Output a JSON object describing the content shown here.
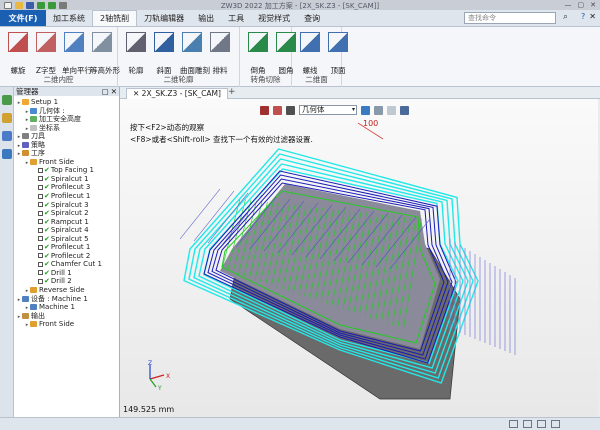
{
  "window": {
    "title": "ZW3D 2022      加工方案 - [2X_SK.Z3 - [SK_CAM]]"
  },
  "menu": {
    "file": "文件(F)",
    "tabs": [
      "加工系统",
      "2轴铣削",
      "刀轨编辑器",
      "输出",
      "工具",
      "视觉样式",
      "查询"
    ],
    "active": 1,
    "search_placeholder": "查找命令"
  },
  "ribbon": {
    "groups": [
      {
        "label": "二维内腔",
        "buttons": [
          "螺旋",
          "Z字型",
          "单向平行",
          "等高外形"
        ]
      },
      {
        "label": "二维轮廓",
        "buttons": [
          "轮廓",
          "斜面",
          "曲面雕刻",
          "排料"
        ]
      },
      {
        "label": "转角切除",
        "buttons": [
          "倒角",
          "圆角"
        ]
      },
      {
        "label": "二维面",
        "buttons": [
          "螺线",
          "顶面"
        ]
      }
    ]
  },
  "panel": {
    "title": "管理器",
    "tree": [
      {
        "d": 0,
        "text": "Setup 1",
        "icon": "#f0a830"
      },
      {
        "d": 1,
        "text": "几何体 :",
        "icon": "#4a8ad0"
      },
      {
        "d": 1,
        "text": "加工安全高度",
        "icon": "#60b060"
      },
      {
        "d": 1,
        "text": "坐标系",
        "icon": "#c0c0c0"
      },
      {
        "d": 0,
        "text": "刀具",
        "icon": "#808080"
      },
      {
        "d": 0,
        "text": "策略",
        "icon": "#6060c0"
      },
      {
        "d": 0,
        "text": "工序",
        "icon": "#d09030"
      },
      {
        "d": 1,
        "text": "Front Side",
        "icon": "#e0a030"
      },
      {
        "d": 2,
        "text": "Top Facing 1",
        "check": true
      },
      {
        "d": 2,
        "text": "Spiralcut 1",
        "check": true
      },
      {
        "d": 2,
        "text": "Profilecut 3",
        "check": true
      },
      {
        "d": 2,
        "text": "Profilecut 1",
        "check": true
      },
      {
        "d": 2,
        "text": "Spiralcut 3",
        "check": true
      },
      {
        "d": 2,
        "text": "Spiralcut 2",
        "check": true
      },
      {
        "d": 2,
        "text": "Rampcut 1",
        "check": true
      },
      {
        "d": 2,
        "text": "Spiralcut 4",
        "check": true
      },
      {
        "d": 2,
        "text": "Spiralcut 5",
        "check": true
      },
      {
        "d": 2,
        "text": "Profilecut 1",
        "check": true
      },
      {
        "d": 2,
        "text": "Profilecut 2",
        "check": true
      },
      {
        "d": 2,
        "text": "Chamfer Cut 1",
        "check": true
      },
      {
        "d": 2,
        "text": "Drill 1",
        "check": true
      },
      {
        "d": 2,
        "text": "Drill 2",
        "check": true
      },
      {
        "d": 1,
        "text": "Reverse Side",
        "icon": "#e0a030"
      },
      {
        "d": 0,
        "text": "设备 : Machine 1",
        "icon": "#5080c0"
      },
      {
        "d": 1,
        "text": "Machine 1",
        "icon": "#5080c0"
      },
      {
        "d": 0,
        "text": "输出",
        "icon": "#c09040"
      },
      {
        "d": 1,
        "text": "Front Side",
        "icon": "#e0a030"
      }
    ]
  },
  "doc": {
    "tab": "2X_SK.Z3 - [SK_CAM]"
  },
  "viewport": {
    "filter_value": "几何体",
    "hint1": "按下<F2>动态的观察",
    "hint2": "<F8>或者<Shift-roll> 查找下一个有效的过滤器设置.",
    "annotation": "100",
    "distance": "149.525 mm",
    "axes": {
      "x": "X",
      "y": "Y",
      "z": "Z"
    }
  },
  "colors": {
    "accent": "#1b5fb3",
    "toolpath_green": "#22cc22",
    "toolpath_cyan": "#22e8e8",
    "toolpath_blue": "#1a1ab8",
    "toolpath_purple": "#7a7ad8"
  }
}
